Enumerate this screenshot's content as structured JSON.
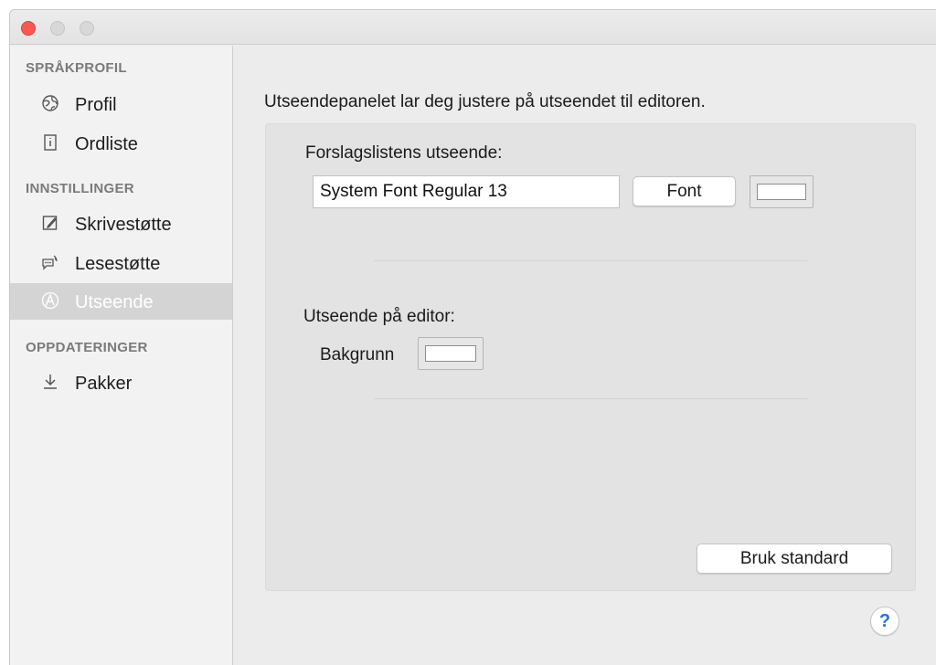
{
  "sidebar": {
    "sections": [
      {
        "header": "SPRÅKPROFIL"
      },
      {
        "header": "INNSTILLINGER"
      },
      {
        "header": "OPPDATERINGER"
      }
    ],
    "items": [
      {
        "label": "Profil",
        "icon": "globe-icon"
      },
      {
        "label": "Ordliste",
        "icon": "book-icon"
      },
      {
        "label": "Skrivestøtte",
        "icon": "pencil-icon"
      },
      {
        "label": "Lesestøtte",
        "icon": "speech-bubble-icon"
      },
      {
        "label": "Utseende",
        "icon": "appearance-icon",
        "selected": true
      },
      {
        "label": "Pakker",
        "icon": "download-icon"
      }
    ]
  },
  "main": {
    "intro": "Utseendepanelet lar deg justere på utseendet til editoren.",
    "suggestion_list": {
      "heading": "Forslagslistens utseende:",
      "font_value": "System Font Regular 13",
      "font_button": "Font"
    },
    "editor": {
      "heading": "Utseende på editor:",
      "background_label": "Bakgrunn"
    },
    "default_button": "Bruk standard",
    "help_button": "?"
  },
  "colors": {
    "close": "#fc5753",
    "selection": "#d4d4d4",
    "help_accent": "#2a6fe0"
  }
}
